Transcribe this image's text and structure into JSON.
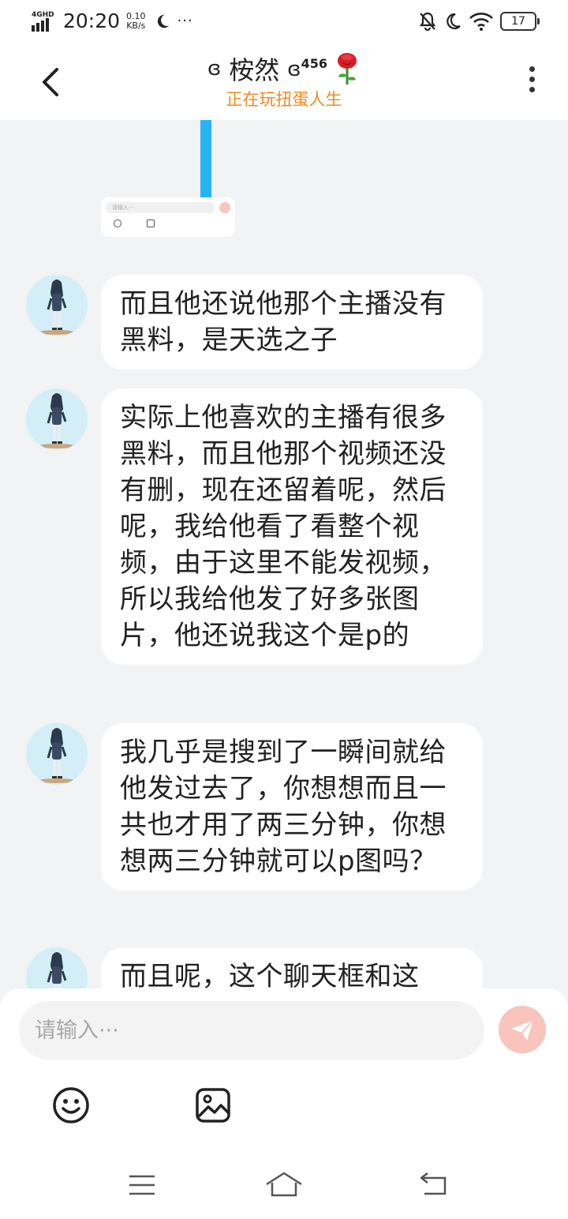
{
  "status_bar": {
    "network": "4GHD",
    "time": "20:20",
    "speed_value": "0.10",
    "speed_unit": "KB/s",
    "more": "···",
    "battery": "17"
  },
  "header": {
    "title_prefix": "ɞ",
    "title": "桉然",
    "title_suffix": "ɞ",
    "title_superscript": "456",
    "subtitle": "正在玩扭蛋人生"
  },
  "thumbnail": {
    "input_placeholder": "请输入···"
  },
  "messages": [
    {
      "text": "而且他还说他那个主播没有黑料，是天选之子"
    },
    {
      "text": "实际上他喜欢的主播有很多黑料，而且他那个视频还没有删，现在还留着呢，然后呢，我给他看了看整个视频，由于这里不能发视频，所以我给他发了好多张图片，他还说我这个是p的"
    },
    {
      "text": "我几乎是搜到了一瞬间就给他发过去了，你想想而且一共也才用了两三分钟，你想想两三分钟就可以p图吗？"
    },
    {
      "text": "而且呢，这个聊天框和这"
    }
  ],
  "input": {
    "placeholder": "请输入···",
    "value": ""
  },
  "colors": {
    "accent_orange": "#f08a24",
    "send_button": "#f8c4bc",
    "chat_background": "#f2f3f5",
    "avatar_background": "#d3eef7",
    "thumbnail_bar": "#27b4f5"
  },
  "icons": {
    "back": "chevron-left-icon",
    "more": "more-vertical-icon",
    "send": "paper-plane-icon",
    "emoji": "smiley-icon",
    "image": "image-icon",
    "menu": "menu-icon",
    "home": "home-icon",
    "back_nav": "return-icon"
  }
}
